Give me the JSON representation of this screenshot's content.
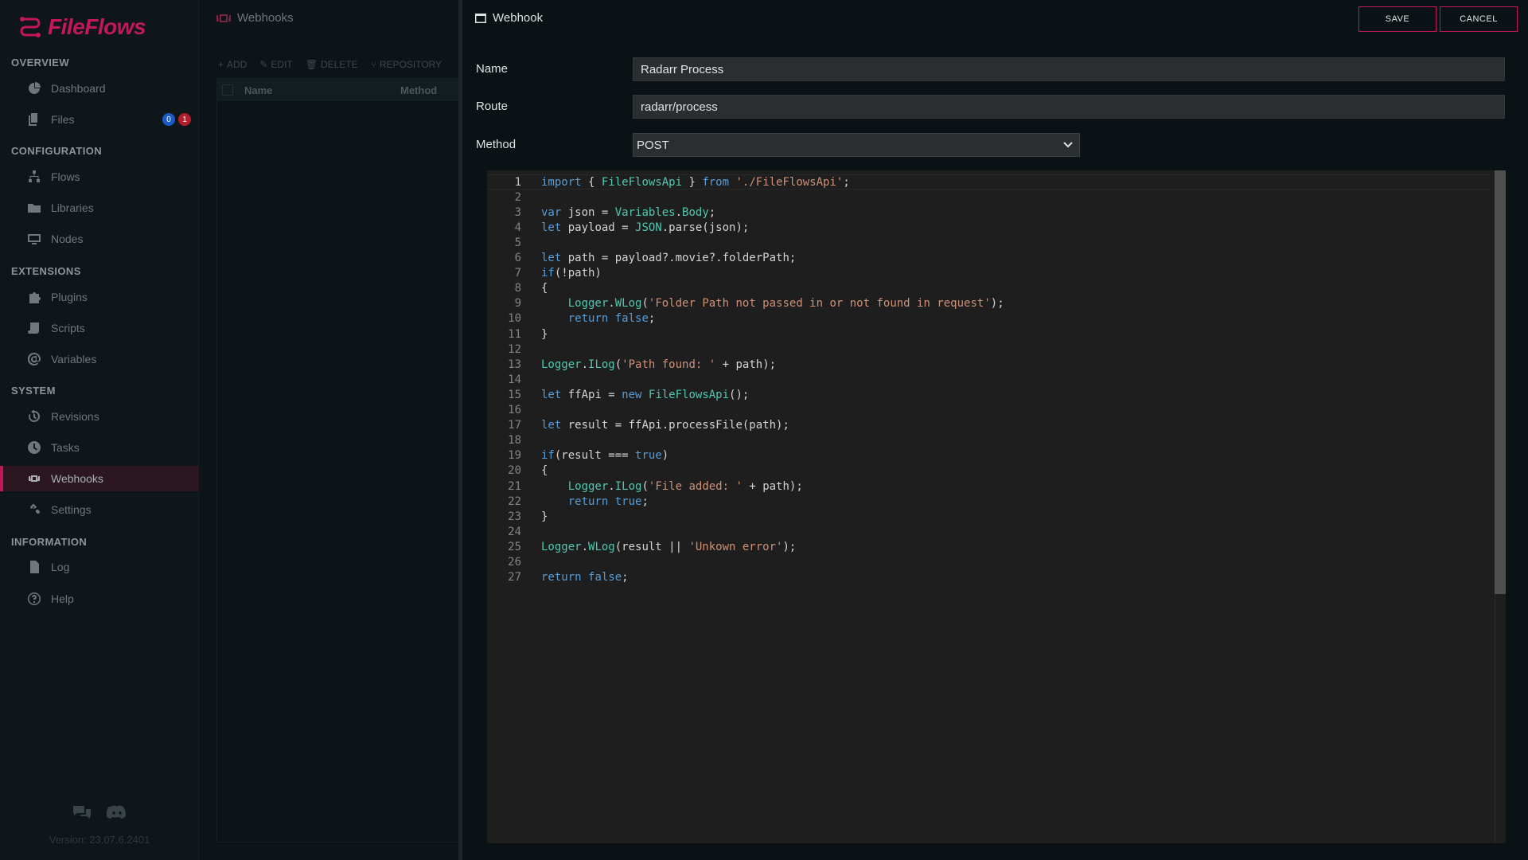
{
  "app": {
    "logo_text": "FileFlows",
    "version": "Version: 23.07.6.2401"
  },
  "sidebar": {
    "sections": [
      {
        "label": "OVERVIEW"
      },
      {
        "label": "CONFIGURATION"
      },
      {
        "label": "EXTENSIONS"
      },
      {
        "label": "SYSTEM"
      },
      {
        "label": "INFORMATION"
      }
    ],
    "items": [
      {
        "label": "Dashboard",
        "icon": "dashboard-icon"
      },
      {
        "label": "Files",
        "icon": "files-icon",
        "badge_blue": "0",
        "badge_red": "1"
      },
      {
        "label": "Flows",
        "icon": "flows-icon"
      },
      {
        "label": "Libraries",
        "icon": "folder-icon"
      },
      {
        "label": "Nodes",
        "icon": "monitor-icon"
      },
      {
        "label": "Plugins",
        "icon": "puzzle-icon"
      },
      {
        "label": "Scripts",
        "icon": "scroll-icon"
      },
      {
        "label": "Variables",
        "icon": "at-icon"
      },
      {
        "label": "Revisions",
        "icon": "history-icon"
      },
      {
        "label": "Tasks",
        "icon": "clock-icon"
      },
      {
        "label": "Webhooks",
        "icon": "webhook-icon",
        "active": true
      },
      {
        "label": "Settings",
        "icon": "gears-icon"
      },
      {
        "label": "Log",
        "icon": "file-lines-icon"
      },
      {
        "label": "Help",
        "icon": "help-icon"
      }
    ]
  },
  "list": {
    "title": "Webhooks",
    "toolbar": {
      "add": "ADD",
      "edit": "EDIT",
      "delete": "DELETE",
      "repository": "REPOSITORY"
    },
    "columns": {
      "name": "Name",
      "method": "Method"
    }
  },
  "editor": {
    "title": "Webhook",
    "save_label": "SAVE",
    "cancel_label": "CANCEL",
    "fields": {
      "name_label": "Name",
      "name_value": "Radarr Process",
      "route_label": "Route",
      "route_value": "radarr/process",
      "method_label": "Method",
      "method_value": "POST"
    }
  },
  "code": {
    "lines": [
      "import { FileFlowsApi } from './FileFlowsApi';",
      "",
      "var json = Variables.Body;",
      "let payload = JSON.parse(json);",
      "",
      "let path = payload?.movie?.folderPath;",
      "if(!path)",
      "{",
      "    Logger.WLog('Folder Path not passed in or not found in request');",
      "    return false;",
      "}",
      "",
      "Logger.ILog('Path found: ' + path);",
      "",
      "let ffApi = new FileFlowsApi();",
      "",
      "let result = ffApi.processFile(path);",
      "",
      "if(result === true)",
      "{",
      "    Logger.ILog('File added: ' + path);",
      "    return true;",
      "}",
      "",
      "Logger.WLog(result || 'Unkown error');",
      "",
      "return false;"
    ]
  }
}
